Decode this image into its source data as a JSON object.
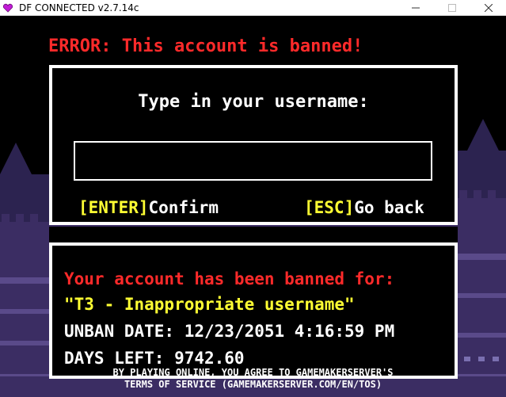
{
  "window": {
    "title": "DF CONNECTED v2.7.14c",
    "icon": "heart-icon",
    "controls": [
      "minimize-icon",
      "maximize-icon",
      "close-icon"
    ]
  },
  "error": {
    "title": "ERROR: This account is banned!"
  },
  "username_dialog": {
    "prompt": "Type in your username:",
    "input_value": "",
    "confirm_key": "[ENTER]",
    "confirm_label": "Confirm",
    "back_key": "[ESC]",
    "back_label": "Go back"
  },
  "ban_info": {
    "heading": "Your account has been banned for:",
    "reason": "\"T3 - Inappropriate username\"",
    "unban_date": "UNBAN DATE: 12/23/2051 4:16:59 PM",
    "days_left": "DAYS LEFT: 9742.60"
  },
  "footer": {
    "line1": "BY PLAYING ONLINE, YOU AGREE TO GAMEMAKERSERVER'S",
    "line2": "TERMS OF SERVICE (GAMEMAKERSERVER.COM/EN/TOS)"
  },
  "colors": {
    "background": "#000000",
    "error_red": "#ff2a2a",
    "key_yellow": "#ffff33",
    "text_white": "#ffffff",
    "castle_purple": "#3b2d63",
    "castle_light": "#7a6fb0",
    "heart": "#c21bd6"
  }
}
